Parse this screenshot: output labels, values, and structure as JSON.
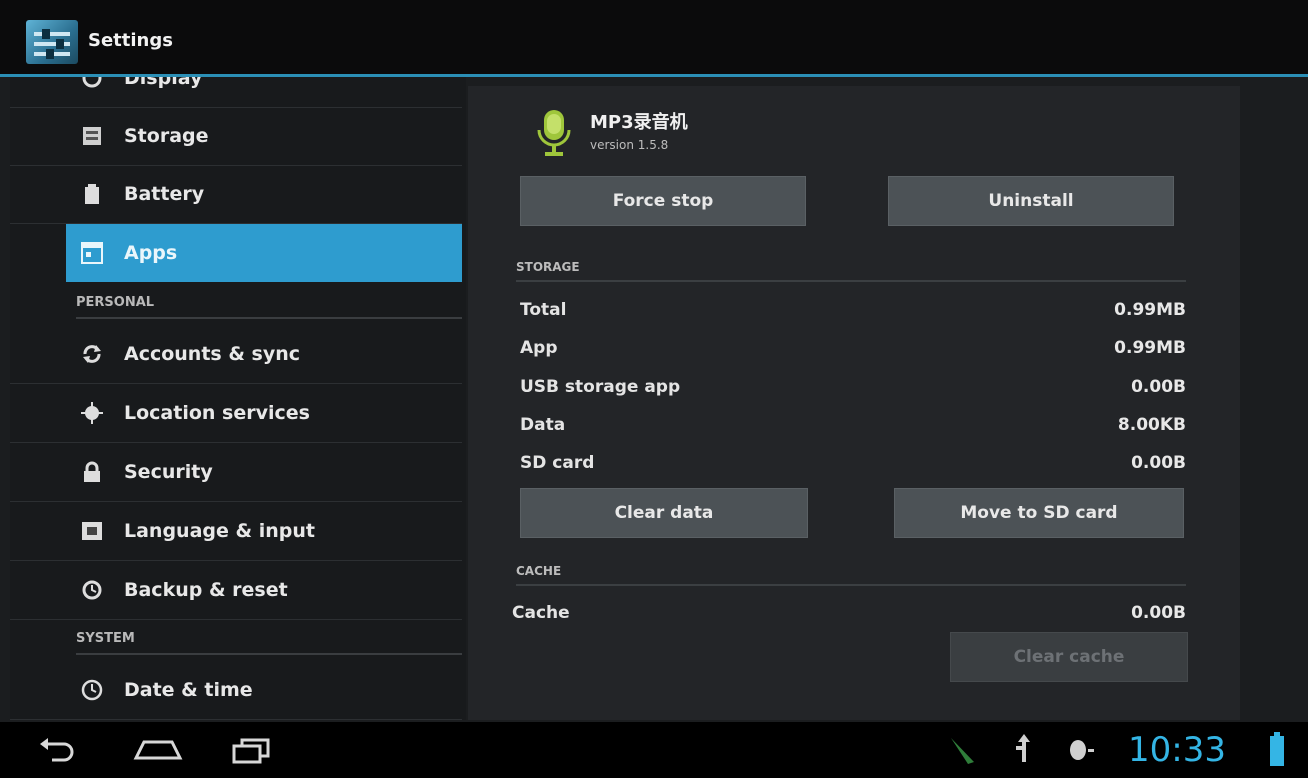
{
  "action_bar": {
    "title": "Settings",
    "icon": "settings-icon"
  },
  "left_menu": {
    "top_partial_label": "Display",
    "items_device": [
      {
        "label": "Storage",
        "icon": "storage-icon"
      },
      {
        "label": "Battery",
        "icon": "battery-icon"
      },
      {
        "label": "Apps",
        "icon": "apps-icon",
        "selected": true
      }
    ],
    "section_personal": "PERSONAL",
    "items_personal": [
      {
        "label": "Accounts & sync",
        "icon": "sync-icon"
      },
      {
        "label": "Location services",
        "icon": "location-icon"
      },
      {
        "label": "Security",
        "icon": "lock-icon"
      },
      {
        "label": "Language & input",
        "icon": "keyboard-icon"
      },
      {
        "label": "Backup & reset",
        "icon": "backup-icon"
      }
    ],
    "section_system": "SYSTEM",
    "items_system": [
      {
        "label": "Date & time",
        "icon": "clock-icon"
      }
    ]
  },
  "app_info": {
    "name": "MP3录音机",
    "version": "version 1.5.8",
    "icon": "microphone-icon",
    "force_stop_label": "Force stop",
    "uninstall_label": "Uninstall",
    "storage_header": "STORAGE",
    "storage_rows": [
      {
        "label": "Total",
        "value": "0.99MB"
      },
      {
        "label": "App",
        "value": "0.99MB"
      },
      {
        "label": "USB storage app",
        "value": "0.00B"
      },
      {
        "label": "Data",
        "value": "8.00KB"
      },
      {
        "label": "SD card",
        "value": "0.00B"
      }
    ],
    "clear_data_label": "Clear data",
    "move_to_sd_label": "Move to SD card",
    "cache_header": "CACHE",
    "cache_rows": [
      {
        "label": "Cache",
        "value": "0.00B"
      }
    ],
    "clear_cache_label": "Clear cache"
  },
  "nav_bar": {
    "time": "10:33",
    "icons": [
      "back-icon",
      "home-icon",
      "recent-apps-icon",
      "notification-icon",
      "usb-icon",
      "debug-icon",
      "battery-status-icon"
    ]
  },
  "colors": {
    "accent": "#2e9ccf",
    "clock": "#34b5e5"
  }
}
